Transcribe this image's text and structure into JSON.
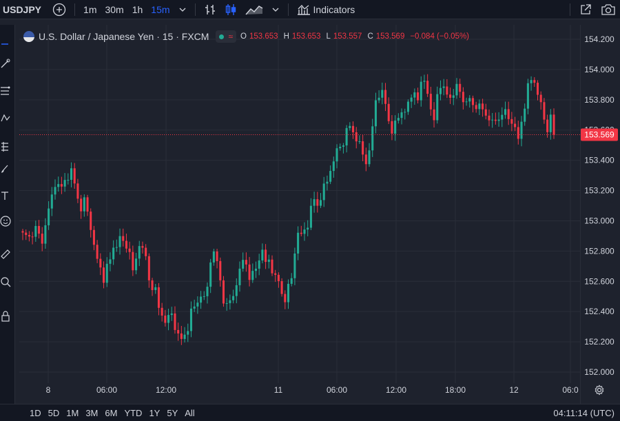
{
  "toolbar": {
    "symbol": "USDJPY",
    "timeframes": [
      "1m",
      "30m",
      "1h",
      "15m"
    ],
    "active_timeframe": "15m",
    "indicators_label": "Indicators"
  },
  "legend": {
    "title": "U.S. Dollar / Japanese Yen · 15 · FXCM",
    "open_label": "O",
    "open": "153.653",
    "high_label": "H",
    "high": "153.653",
    "low_label": "L",
    "low": "153.557",
    "close_label": "C",
    "close": "153.569",
    "change": "−0.084 (−0.05%)"
  },
  "bottom": {
    "ranges": [
      "1D",
      "5D",
      "1M",
      "3M",
      "6M",
      "YTD",
      "1Y",
      "5Y",
      "All"
    ],
    "clock": "04:11:14 (UTC)"
  },
  "colors": {
    "up": "#22ab94",
    "down": "#f23645",
    "background": "#1e222d",
    "grid": "#2a2e39",
    "accent": "#2962ff"
  },
  "chart_data": {
    "type": "candlestick",
    "title": "U.S. Dollar / Japanese Yen · 15 · FXCM",
    "ylim": [
      152.0,
      154.2
    ],
    "y_ticks": [
      "154.200",
      "154.000",
      "153.800",
      "153.600",
      "153.400",
      "153.200",
      "153.000",
      "152.800",
      "152.600",
      "152.400",
      "152.200",
      "152.000"
    ],
    "x_ticks": [
      "8",
      "06:00",
      "12:00",
      "11",
      "06:00",
      "12:00",
      "18:00",
      "12",
      "06:0"
    ],
    "last_price": "153.569",
    "grid": true,
    "close_path": [
      [
        0,
        152.91
      ],
      [
        2,
        152.89
      ],
      [
        4,
        152.95
      ],
      [
        6,
        152.86
      ],
      [
        7,
        152.98
      ],
      [
        9,
        153.16
      ],
      [
        10,
        153.25
      ],
      [
        12,
        153.22
      ],
      [
        14,
        153.3
      ],
      [
        15,
        153.33
      ],
      [
        16,
        153.24
      ],
      [
        17,
        153.15
      ],
      [
        18,
        153.08
      ],
      [
        19,
        153.14
      ],
      [
        21,
        152.96
      ],
      [
        22,
        152.84
      ],
      [
        23,
        152.74
      ],
      [
        25,
        152.62
      ],
      [
        26,
        152.7
      ],
      [
        27,
        152.74
      ],
      [
        28,
        152.82
      ],
      [
        30,
        152.88
      ],
      [
        31,
        152.86
      ],
      [
        33,
        152.8
      ],
      [
        34,
        152.66
      ],
      [
        35,
        152.74
      ],
      [
        36,
        152.86
      ],
      [
        38,
        152.76
      ],
      [
        39,
        152.6
      ],
      [
        41,
        152.54
      ],
      [
        42,
        152.42
      ],
      [
        44,
        152.34
      ],
      [
        46,
        152.38
      ],
      [
        47,
        152.3
      ],
      [
        48,
        152.25
      ],
      [
        49,
        152.21
      ],
      [
        50,
        152.24
      ],
      [
        51,
        152.3
      ],
      [
        52,
        152.4
      ],
      [
        54,
        152.46
      ],
      [
        55,
        152.52
      ],
      [
        56,
        152.48
      ],
      [
        57,
        152.56
      ],
      [
        58,
        152.74
      ],
      [
        59,
        152.8
      ],
      [
        60,
        152.72
      ],
      [
        61,
        152.6
      ],
      [
        62,
        152.48
      ],
      [
        63,
        152.44
      ],
      [
        65,
        152.5
      ],
      [
        66,
        152.6
      ],
      [
        67,
        152.66
      ],
      [
        68,
        152.74
      ],
      [
        69,
        152.72
      ],
      [
        70,
        152.62
      ],
      [
        72,
        152.68
      ],
      [
        73,
        152.76
      ],
      [
        74,
        152.8
      ],
      [
        75,
        152.72
      ],
      [
        76,
        152.74
      ],
      [
        77,
        152.68
      ],
      [
        78,
        152.62
      ],
      [
        79,
        152.6
      ],
      [
        80,
        152.52
      ],
      [
        81,
        152.48
      ],
      [
        82,
        152.56
      ],
      [
        83,
        152.62
      ],
      [
        84,
        152.8
      ],
      [
        85,
        152.92
      ],
      [
        86,
        152.9
      ],
      [
        88,
        152.98
      ],
      [
        89,
        153.08
      ],
      [
        90,
        153.14
      ],
      [
        91,
        153.1
      ],
      [
        93,
        153.22
      ],
      [
        94,
        153.26
      ],
      [
        95,
        153.34
      ],
      [
        96,
        153.4
      ],
      [
        97,
        153.46
      ],
      [
        99,
        153.52
      ],
      [
        100,
        153.6
      ],
      [
        101,
        153.62
      ],
      [
        103,
        153.55
      ],
      [
        104,
        153.5
      ],
      [
        105,
        153.44
      ],
      [
        106,
        153.38
      ],
      [
        107,
        153.48
      ],
      [
        108,
        153.6
      ],
      [
        109,
        153.8
      ],
      [
        110,
        153.83
      ],
      [
        111,
        153.86
      ],
      [
        112,
        153.76
      ],
      [
        113,
        153.66
      ],
      [
        114,
        153.6
      ],
      [
        116,
        153.68
      ],
      [
        117,
        153.72
      ],
      [
        119,
        153.76
      ],
      [
        120,
        153.82
      ],
      [
        121,
        153.86
      ],
      [
        122,
        153.8
      ],
      [
        123,
        153.9
      ],
      [
        124,
        153.93
      ],
      [
        125,
        153.86
      ],
      [
        126,
        153.72
      ],
      [
        127,
        153.66
      ],
      [
        128,
        153.84
      ],
      [
        129,
        153.9
      ],
      [
        130,
        153.86
      ],
      [
        132,
        153.82
      ],
      [
        133,
        153.84
      ],
      [
        134,
        153.88
      ],
      [
        135,
        153.86
      ],
      [
        136,
        153.8
      ],
      [
        137,
        153.78
      ],
      [
        138,
        153.8
      ],
      [
        139,
        153.77
      ],
      [
        140,
        153.76
      ],
      [
        142,
        153.74
      ],
      [
        143,
        153.7
      ],
      [
        144,
        153.68
      ],
      [
        145,
        153.64
      ],
      [
        146,
        153.67
      ],
      [
        147,
        153.68
      ],
      [
        148,
        153.7
      ],
      [
        149,
        153.72
      ],
      [
        150,
        153.68
      ],
      [
        151,
        153.66
      ],
      [
        152,
        153.6
      ],
      [
        153,
        153.54
      ],
      [
        154,
        153.66
      ],
      [
        155,
        153.76
      ],
      [
        156,
        153.88
      ],
      [
        157,
        153.94
      ],
      [
        158,
        153.92
      ],
      [
        159,
        153.84
      ],
      [
        160,
        153.76
      ],
      [
        161,
        153.68
      ],
      [
        162,
        153.6
      ],
      [
        163,
        153.69
      ],
      [
        164,
        153.57
      ]
    ]
  }
}
